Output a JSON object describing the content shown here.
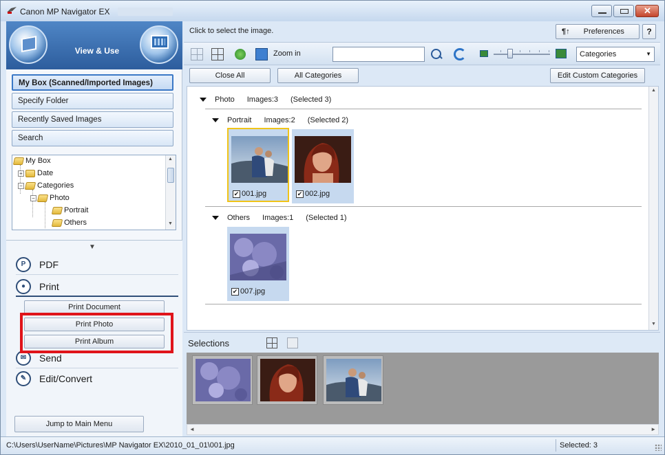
{
  "window": {
    "title": "Canon MP Navigator EX",
    "minimize_icon": "minimize-icon",
    "maximize_icon": "maximize-icon",
    "close_icon": "close-icon"
  },
  "left": {
    "mode_label": "View & Use",
    "nav": [
      {
        "label": "My Box (Scanned/Imported Images)",
        "selected": true
      },
      {
        "label": "Specify Folder",
        "selected": false
      },
      {
        "label": "Recently Saved Images",
        "selected": false
      },
      {
        "label": "Search",
        "selected": false
      }
    ],
    "tree": [
      {
        "label": "My Box"
      },
      {
        "label": "Date"
      },
      {
        "label": "Categories"
      },
      {
        "label": "Photo"
      },
      {
        "label": "Portrait"
      },
      {
        "label": "Others"
      }
    ],
    "expand_glyph": "▼",
    "menu": [
      {
        "label": "PDF",
        "icon": "pdf-icon"
      },
      {
        "label": "Print",
        "icon": "print-icon"
      },
      {
        "label": "Send",
        "icon": "mail-icon"
      },
      {
        "label": "Edit/Convert",
        "icon": "pencil-icon"
      }
    ],
    "print_sub": [
      "Print Document",
      "Print Photo",
      "Print Album"
    ],
    "jump_label": "Jump to Main Menu"
  },
  "right": {
    "hint": "Click to select the image.",
    "preferences_label": "Preferences",
    "help_label": "?",
    "toolbar": {
      "zoom_label": "Zoom in",
      "search_value": "",
      "category_select": "Categories"
    },
    "buttons": {
      "close_all": "Close All",
      "all_categories": "All Categories",
      "edit_custom": "Edit Custom Categories"
    },
    "groups": {
      "photo": {
        "name": "Photo",
        "images": "Images:3",
        "selected": "(Selected 3)"
      },
      "portrait": {
        "name": "Portrait",
        "images": "Images:2",
        "selected": "(Selected 2)"
      },
      "others": {
        "name": "Others",
        "images": "Images:1",
        "selected": "(Selected 1)"
      }
    },
    "thumbs": [
      {
        "file": "001.jpg",
        "checked": true
      },
      {
        "file": "002.jpg",
        "checked": true
      },
      {
        "file": "007.jpg",
        "checked": true
      }
    ],
    "selections_label": "Selections"
  },
  "status": {
    "path": "C:\\Users\\UserName\\Pictures\\MP Navigator EX\\2010_01_01\\001.jpg",
    "selected": "Selected: 3"
  },
  "colors": {
    "accent_blue": "#2d5d9d",
    "highlight_red": "#e0141a",
    "selection_yellow": "#f0c419"
  }
}
